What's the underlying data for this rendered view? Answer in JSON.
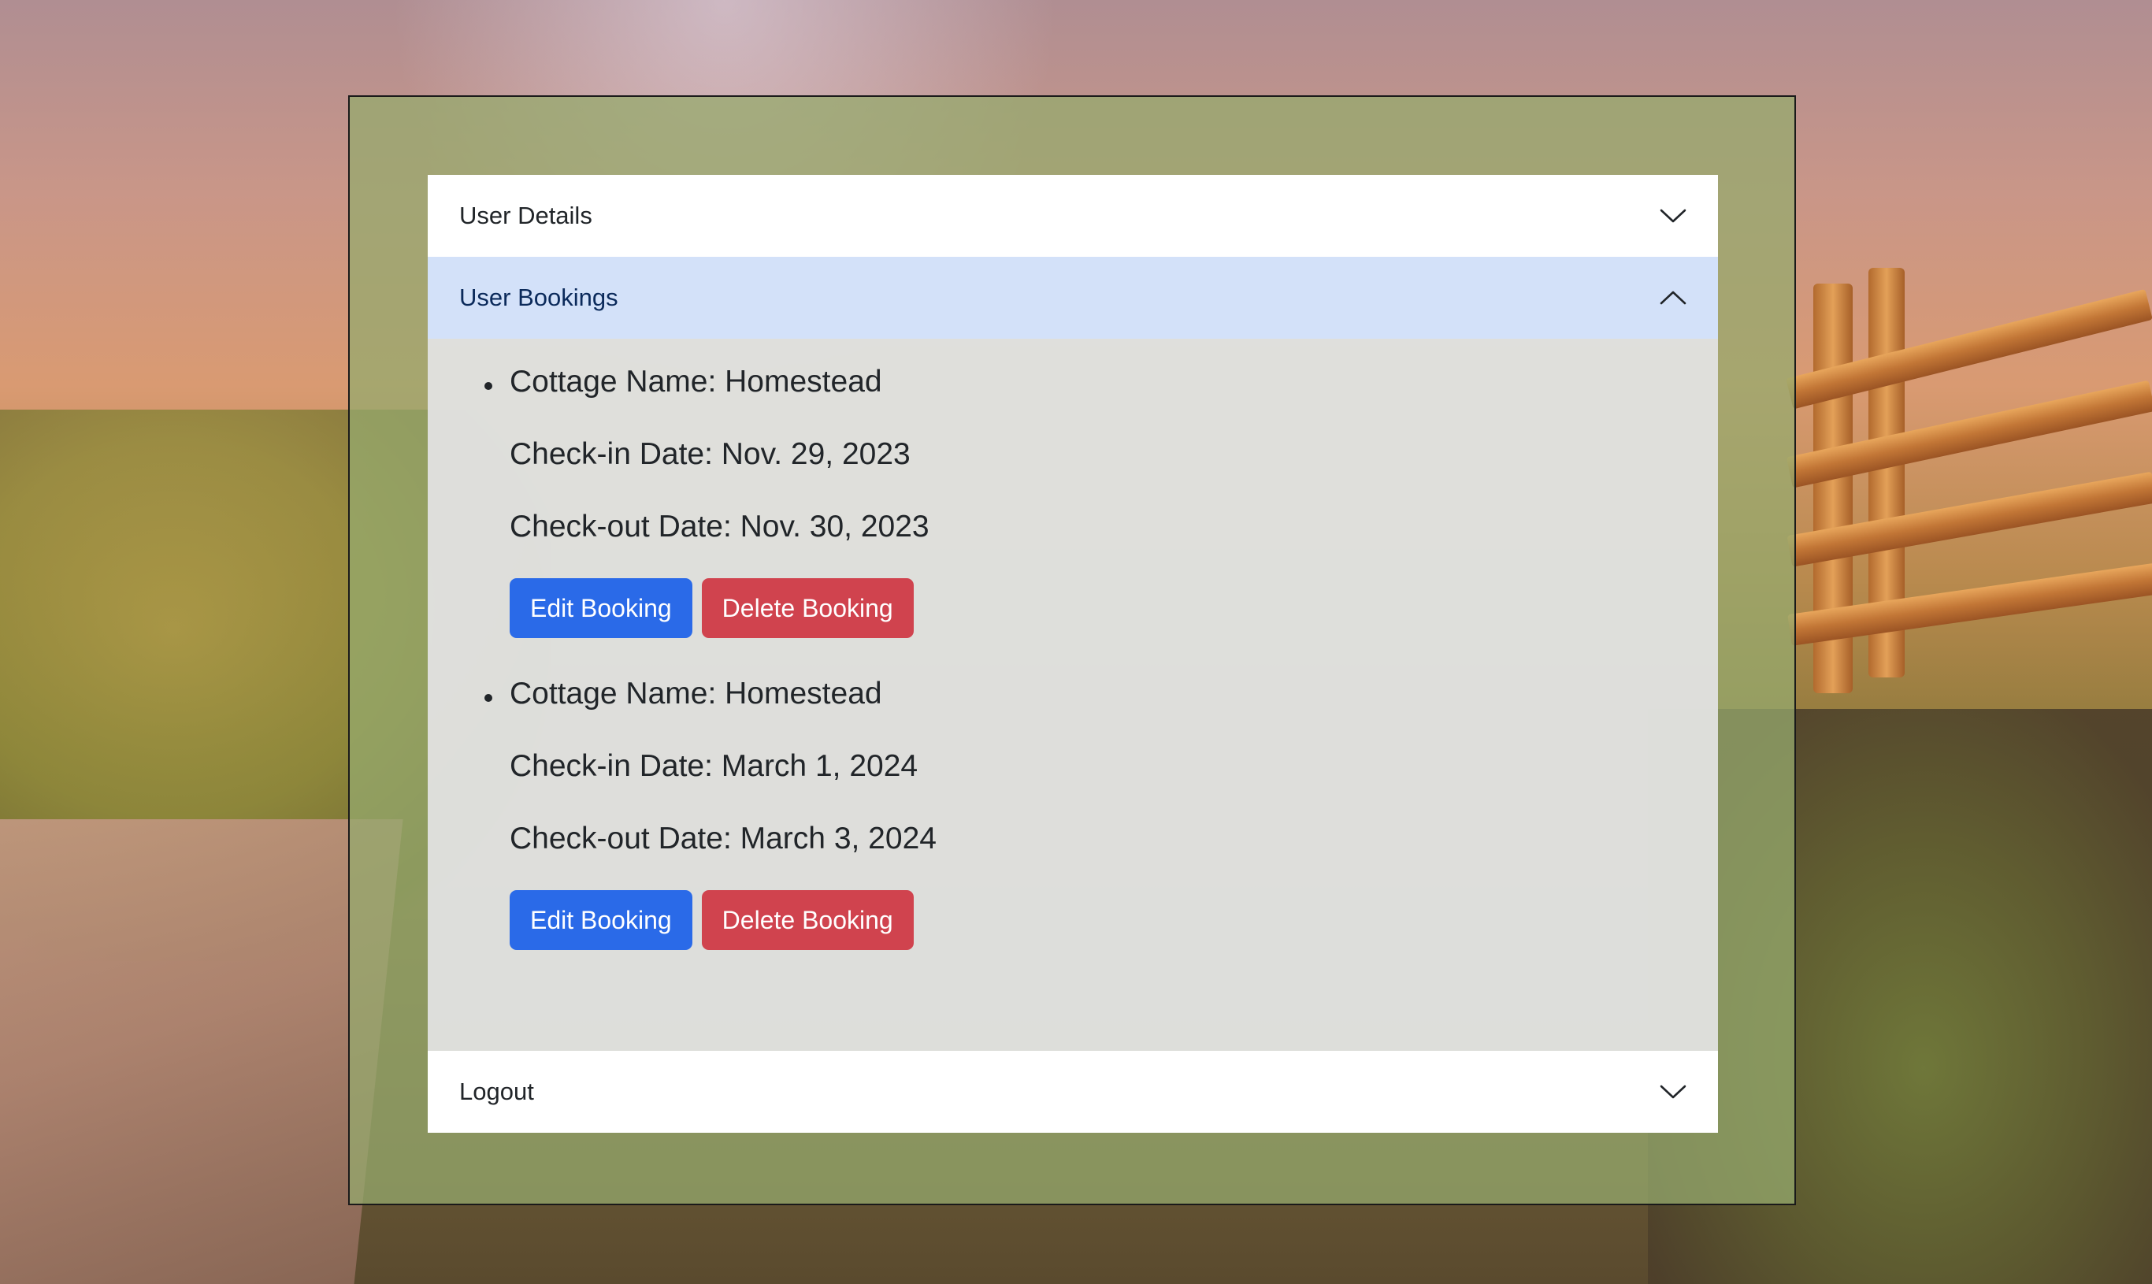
{
  "colors": {
    "primary": "#2a6ae8",
    "danger": "#d0434e",
    "active_header_bg": "#d3e1f9",
    "panel_overlay": "#96aa6e"
  },
  "accordion": {
    "sections": [
      {
        "label": "User Details",
        "expanded": false,
        "icon": "chevron-down-icon"
      },
      {
        "label": "User Bookings",
        "expanded": true,
        "icon": "chevron-up-icon"
      },
      {
        "label": "Logout",
        "expanded": false,
        "icon": "chevron-down-icon"
      }
    ]
  },
  "bookings": [
    {
      "cottage": "Cottage Name: Homestead",
      "check_in": "Check-in Date: Nov. 29, 2023",
      "check_out": "Check-out Date: Nov. 30, 2023",
      "edit_label": "Edit Booking",
      "delete_label": "Delete Booking"
    },
    {
      "cottage": "Cottage Name: Homestead",
      "check_in": "Check-in Date: March 1, 2024",
      "check_out": "Check-out Date: March 3, 2024",
      "edit_label": "Edit Booking",
      "delete_label": "Delete Booking"
    }
  ]
}
